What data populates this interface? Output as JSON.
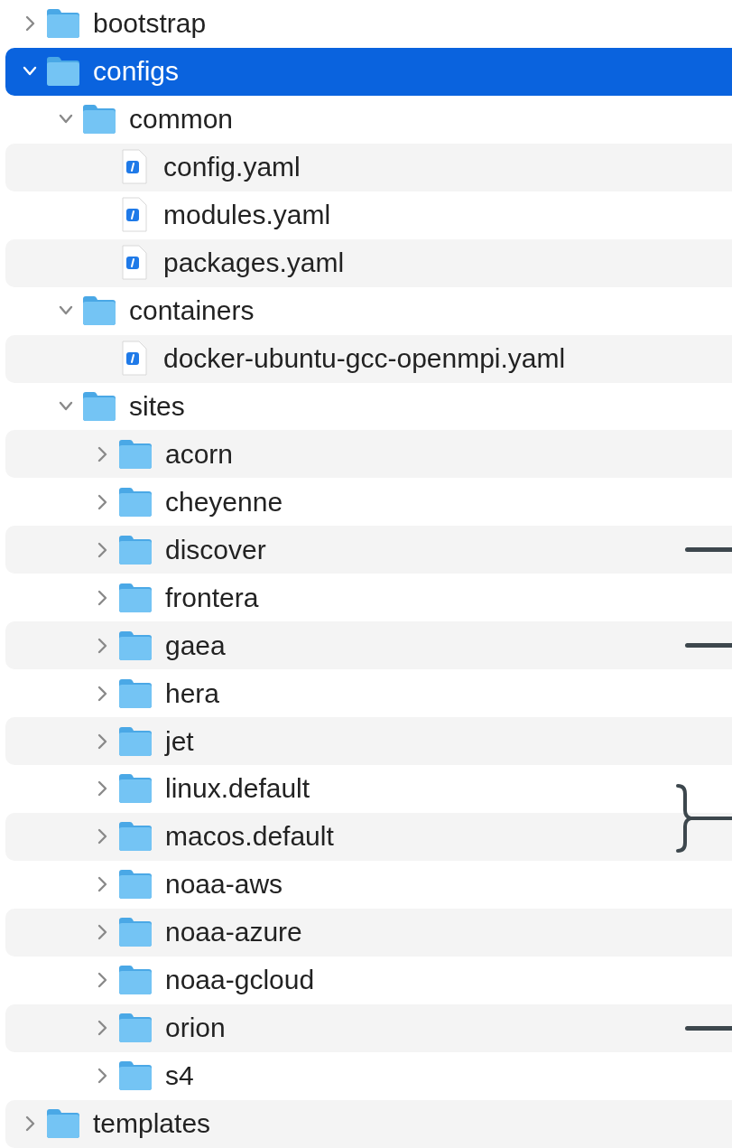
{
  "tree": [
    {
      "kind": "folder",
      "name": "bootstrap",
      "expanded": false,
      "selected": false
    },
    {
      "kind": "folder",
      "name": "configs",
      "expanded": true,
      "selected": true,
      "children": [
        {
          "kind": "folder",
          "name": "common",
          "expanded": true,
          "selected": false,
          "children": [
            {
              "kind": "file",
              "name": "config.yaml",
              "selected": false
            },
            {
              "kind": "file",
              "name": "modules.yaml",
              "selected": false
            },
            {
              "kind": "file",
              "name": "packages.yaml",
              "selected": false
            }
          ]
        },
        {
          "kind": "folder",
          "name": "containers",
          "expanded": true,
          "selected": false,
          "children": [
            {
              "kind": "file",
              "name": "docker-ubuntu-gcc-openmpi.yaml",
              "selected": false
            }
          ]
        },
        {
          "kind": "folder",
          "name": "sites",
          "expanded": true,
          "selected": false,
          "children": [
            {
              "kind": "folder",
              "name": "acorn",
              "expanded": false,
              "selected": false
            },
            {
              "kind": "folder",
              "name": "cheyenne",
              "expanded": false,
              "selected": false
            },
            {
              "kind": "folder",
              "name": "discover",
              "expanded": false,
              "selected": false,
              "annotation": {
                "kind": "line"
              }
            },
            {
              "kind": "folder",
              "name": "frontera",
              "expanded": false,
              "selected": false
            },
            {
              "kind": "folder",
              "name": "gaea",
              "expanded": false,
              "selected": false,
              "annotation": {
                "kind": "line"
              }
            },
            {
              "kind": "folder",
              "name": "hera",
              "expanded": false,
              "selected": false
            },
            {
              "kind": "folder",
              "name": "jet",
              "expanded": false,
              "selected": false
            },
            {
              "kind": "folder",
              "name": "linux.default",
              "expanded": false,
              "selected": false,
              "annotation": {
                "kind": "brace"
              }
            },
            {
              "kind": "folder",
              "name": "macos.default",
              "expanded": false,
              "selected": false
            },
            {
              "kind": "folder",
              "name": "noaa-aws",
              "expanded": false,
              "selected": false
            },
            {
              "kind": "folder",
              "name": "noaa-azure",
              "expanded": false,
              "selected": false
            },
            {
              "kind": "folder",
              "name": "noaa-gcloud",
              "expanded": false,
              "selected": false
            },
            {
              "kind": "folder",
              "name": "orion",
              "expanded": false,
              "selected": false,
              "annotation": {
                "kind": "line"
              }
            },
            {
              "kind": "folder",
              "name": "s4",
              "expanded": false,
              "selected": false
            }
          ]
        }
      ]
    },
    {
      "kind": "folder",
      "name": "templates",
      "expanded": false,
      "selected": false
    }
  ]
}
